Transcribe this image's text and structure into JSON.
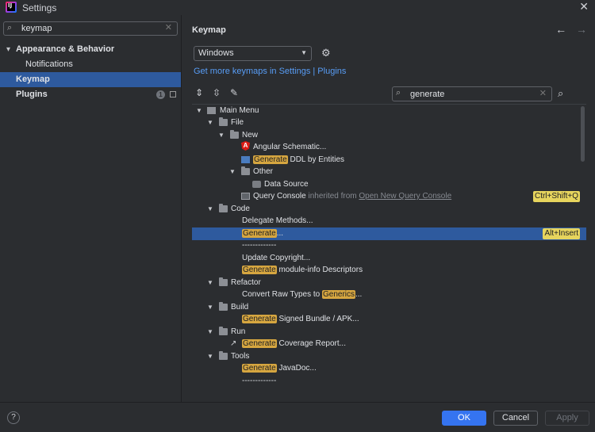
{
  "window": {
    "title": "Settings",
    "close": "✕"
  },
  "sidebar": {
    "search_value": "keymap",
    "items": [
      {
        "label": "Appearance & Behavior",
        "caret": "▾"
      },
      {
        "label": "Notifications"
      },
      {
        "label": "Keymap"
      },
      {
        "label": "Plugins",
        "badge": "1"
      }
    ]
  },
  "main": {
    "title": "Keymap",
    "back": "←",
    "forward": "→",
    "keymap_value": "Windows",
    "link": "Get more keymaps in Settings | Plugins",
    "filter_value": "generate"
  },
  "tree": {
    "rows": [
      {
        "label": "Main Menu"
      },
      {
        "label": "File"
      },
      {
        "label": "New"
      },
      {
        "label": "Angular Schematic..."
      },
      {
        "hl": "Generate",
        "rest": " DDL by Entities"
      },
      {
        "label": "Other"
      },
      {
        "label": "Data Source"
      },
      {
        "label": "Query Console",
        "inherited": " inherited from ",
        "inherited_link": "Open New Query Console",
        "shortcut": "Ctrl+Shift+Q"
      },
      {
        "label": "Code"
      },
      {
        "label": "Delegate Methods..."
      },
      {
        "hl": "Generate",
        "rest": "...",
        "shortcut": "Alt+Insert"
      },
      {
        "label": "-------------"
      },
      {
        "label": "Update Copyright..."
      },
      {
        "hl": "Generate",
        "rest": " module-info Descriptors"
      },
      {
        "label": "Refactor"
      },
      {
        "pre": "Convert Raw Types to ",
        "hl": "Generics",
        "rest": "..."
      },
      {
        "label": "Build"
      },
      {
        "hl": "Generate",
        "rest": " Signed Bundle / APK..."
      },
      {
        "label": "Run"
      },
      {
        "hl": "Generate",
        "rest": " Coverage Report..."
      },
      {
        "label": "Tools"
      },
      {
        "hl": "Generate",
        "rest": " JavaDoc..."
      },
      {
        "label": "-------------"
      }
    ]
  },
  "buttons": {
    "help": "?",
    "ok": "OK",
    "cancel": "Cancel",
    "apply": "Apply"
  },
  "colors": {
    "accent": "#3574f0",
    "selection": "#2e5a9e",
    "highlight": "#d6a640",
    "shortcut_bg": "#e6d45d"
  }
}
